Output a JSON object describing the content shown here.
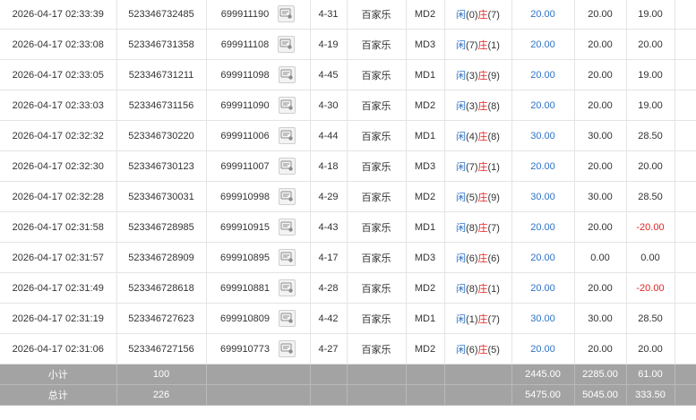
{
  "theme": {
    "summary_bg": "#a3a3a3",
    "bet_blue": "#2e73c7",
    "loss_red": "#e02424",
    "grid_line": "#e4e4e4"
  },
  "rows": [
    {
      "time": "2026-04-17 02:33:39",
      "bet_id": "523346732485",
      "round": "699911190",
      "table": "4-31",
      "game": "百家乐",
      "type": "MD2",
      "player_label": "闲",
      "player_score": "(0)",
      "banker_label": "庄",
      "banker_score": "(7)",
      "bet": "20.00",
      "valid": "20.00",
      "win": "19.00",
      "win_negative": false
    },
    {
      "time": "2026-04-17 02:33:08",
      "bet_id": "523346731358",
      "round": "699911108",
      "table": "4-19",
      "game": "百家乐",
      "type": "MD3",
      "player_label": "闲",
      "player_score": "(7)",
      "banker_label": "庄",
      "banker_score": "(1)",
      "bet": "20.00",
      "valid": "20.00",
      "win": "20.00",
      "win_negative": false
    },
    {
      "time": "2026-04-17 02:33:05",
      "bet_id": "523346731211",
      "round": "699911098",
      "table": "4-45",
      "game": "百家乐",
      "type": "MD1",
      "player_label": "闲",
      "player_score": "(3)",
      "banker_label": "庄",
      "banker_score": "(9)",
      "bet": "20.00",
      "valid": "20.00",
      "win": "19.00",
      "win_negative": false
    },
    {
      "time": "2026-04-17 02:33:03",
      "bet_id": "523346731156",
      "round": "699911090",
      "table": "4-30",
      "game": "百家乐",
      "type": "MD2",
      "player_label": "闲",
      "player_score": "(3)",
      "banker_label": "庄",
      "banker_score": "(8)",
      "bet": "20.00",
      "valid": "20.00",
      "win": "19.00",
      "win_negative": false
    },
    {
      "time": "2026-04-17 02:32:32",
      "bet_id": "523346730220",
      "round": "699911006",
      "table": "4-44",
      "game": "百家乐",
      "type": "MD1",
      "player_label": "闲",
      "player_score": "(4)",
      "banker_label": "庄",
      "banker_score": "(8)",
      "bet": "30.00",
      "valid": "30.00",
      "win": "28.50",
      "win_negative": false
    },
    {
      "time": "2026-04-17 02:32:30",
      "bet_id": "523346730123",
      "round": "699911007",
      "table": "4-18",
      "game": "百家乐",
      "type": "MD3",
      "player_label": "闲",
      "player_score": "(7)",
      "banker_label": "庄",
      "banker_score": "(1)",
      "bet": "20.00",
      "valid": "20.00",
      "win": "20.00",
      "win_negative": false
    },
    {
      "time": "2026-04-17 02:32:28",
      "bet_id": "523346730031",
      "round": "699910998",
      "table": "4-29",
      "game": "百家乐",
      "type": "MD2",
      "player_label": "闲",
      "player_score": "(5)",
      "banker_label": "庄",
      "banker_score": "(9)",
      "bet": "30.00",
      "valid": "30.00",
      "win": "28.50",
      "win_negative": false
    },
    {
      "time": "2026-04-17 02:31:58",
      "bet_id": "523346728985",
      "round": "699910915",
      "table": "4-43",
      "game": "百家乐",
      "type": "MD1",
      "player_label": "闲",
      "player_score": "(8)",
      "banker_label": "庄",
      "banker_score": "(7)",
      "bet": "20.00",
      "valid": "20.00",
      "win": "-20.00",
      "win_negative": true
    },
    {
      "time": "2026-04-17 02:31:57",
      "bet_id": "523346728909",
      "round": "699910895",
      "table": "4-17",
      "game": "百家乐",
      "type": "MD3",
      "player_label": "闲",
      "player_score": "(6)",
      "banker_label": "庄",
      "banker_score": "(6)",
      "bet": "20.00",
      "valid": "0.00",
      "win": "0.00",
      "win_negative": false
    },
    {
      "time": "2026-04-17 02:31:49",
      "bet_id": "523346728618",
      "round": "699910881",
      "table": "4-28",
      "game": "百家乐",
      "type": "MD2",
      "player_label": "闲",
      "player_score": "(8)",
      "banker_label": "庄",
      "banker_score": "(1)",
      "bet": "20.00",
      "valid": "20.00",
      "win": "-20.00",
      "win_negative": true
    },
    {
      "time": "2026-04-17 02:31:19",
      "bet_id": "523346727623",
      "round": "699910809",
      "table": "4-42",
      "game": "百家乐",
      "type": "MD1",
      "player_label": "闲",
      "player_score": "(1)",
      "banker_label": "庄",
      "banker_score": "(7)",
      "bet": "30.00",
      "valid": "30.00",
      "win": "28.50",
      "win_negative": false
    },
    {
      "time": "2026-04-17 02:31:06",
      "bet_id": "523346727156",
      "round": "699910773",
      "table": "4-27",
      "game": "百家乐",
      "type": "MD2",
      "player_label": "闲",
      "player_score": "(6)",
      "banker_label": "庄",
      "banker_score": "(5)",
      "bet": "20.00",
      "valid": "20.00",
      "win": "20.00",
      "win_negative": false
    }
  ],
  "summary": [
    {
      "label": "小计",
      "count": "100",
      "bet": "2445.00",
      "valid": "2285.00",
      "win": "61.00"
    },
    {
      "label": "总计",
      "count": "226",
      "bet": "5475.00",
      "valid": "5045.00",
      "win": "333.50"
    }
  ],
  "icons": {
    "detail": "video-replay-icon"
  }
}
